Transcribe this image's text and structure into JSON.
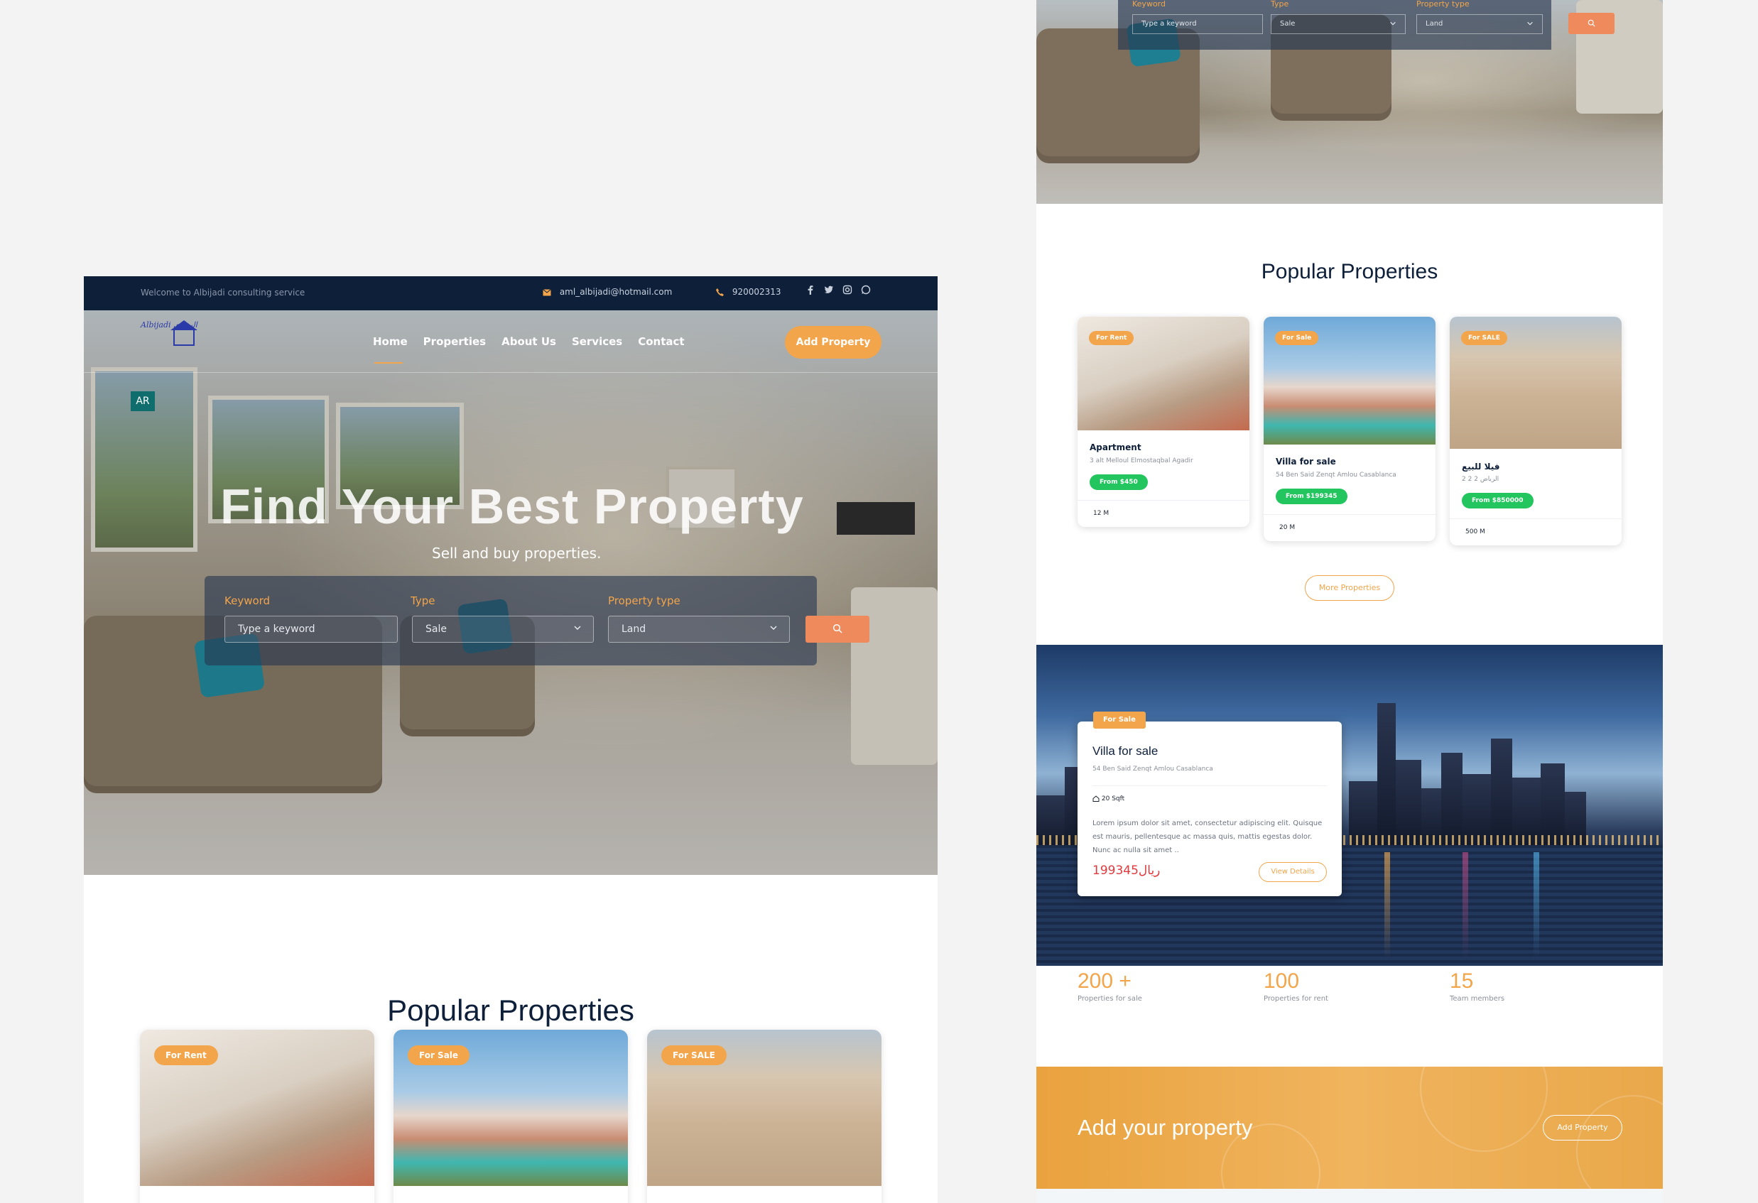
{
  "left_page": {
    "topbar": {
      "welcome": "Welcome to Albijadi consulting service",
      "email": "aml_albijadi@hotmail.com",
      "phone": "920002313"
    },
    "logo_text": "Albijadi البجادي",
    "nav": [
      "Home",
      "Properties",
      "About Us",
      "Services",
      "Contact"
    ],
    "add_property": "Add Property",
    "lang_badge": "AR",
    "hero_title": "Find Your Best Property",
    "hero_subtitle": "Sell and buy properties.",
    "search": {
      "keyword_label": "Keyword",
      "keyword_placeholder": "Type a keyword",
      "type_label": "Type",
      "type_value": "Sale",
      "ptype_label": "Property type",
      "ptype_value": "Land"
    },
    "popular_title": "Popular Properties",
    "cards": [
      {
        "badge": "For Rent"
      },
      {
        "badge": "For Sale"
      },
      {
        "badge": "For SALE"
      }
    ]
  },
  "right_page": {
    "search": {
      "keyword_label": "Keyword",
      "keyword_placeholder": "Type a keyword",
      "type_label": "Type",
      "type_value": "Sale",
      "ptype_label": "Property type",
      "ptype_value": "Land"
    },
    "popular_title": "Popular Properties",
    "cards": [
      {
        "badge": "For Rent",
        "title": "Apartment",
        "address": "3 alt Melloul Elmostaqbal Agadir",
        "price": "From $450",
        "area": "12 M"
      },
      {
        "badge": "For Sale",
        "title": "Villa for sale",
        "address": "54 Ben Said Zenqt Amlou Casablanca",
        "price": "From $199345",
        "area": "20 M"
      },
      {
        "badge": "For SALE",
        "title": "فيلا للبيع",
        "address": "الرياض 2 2 2",
        "price": "From $850000",
        "area": "500 M"
      }
    ],
    "more_button": "More Properties",
    "featured": {
      "badge": "For Sale",
      "title": "Villa for sale",
      "address": "54 Ben Said Zenqt Amlou Casablanca",
      "area": "20 Sqft",
      "description": "Lorem ipsum dolor sit amet, consectetur adipiscing elit. Quisque est mauris, pellentesque ac massa quis, mattis egestas dolor. Nunc ac nulla sit amet ..",
      "price": "199345ريال",
      "view_button": "View Details"
    },
    "stats": [
      {
        "number": "200 +",
        "label": "Properties for sale"
      },
      {
        "number": "100",
        "label": "Properties for rent"
      },
      {
        "number": "15",
        "label": "Team members"
      }
    ],
    "cta": {
      "title": "Add your property",
      "button": "Add Property"
    }
  },
  "colors": {
    "navy": "#0e1f3a",
    "orange": "#f2a54a",
    "price_green": "#22c55e",
    "price_red": "#e0393e"
  }
}
